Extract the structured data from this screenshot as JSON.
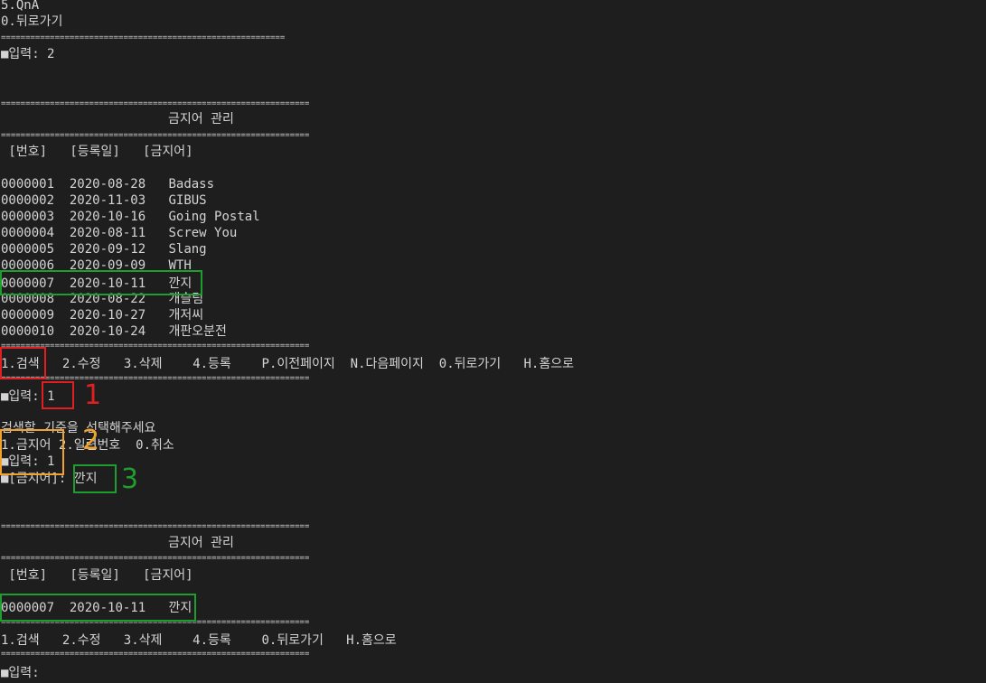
{
  "menu_tail": {
    "line1": "5.QnA",
    "line2": "0.뒤로가기",
    "prompt": "■입력: 2"
  },
  "separator_short": "==========================================================",
  "separator_long": "===============================================================",
  "list_screen": {
    "title": "금지어 관리",
    "header": " [번호]   [등록일]   [금지어]",
    "rows": [
      {
        "no": "0000001",
        "date": "2020-08-28",
        "word": "Badass"
      },
      {
        "no": "0000002",
        "date": "2020-11-03",
        "word": "GIBUS"
      },
      {
        "no": "0000003",
        "date": "2020-10-16",
        "word": "Going Postal"
      },
      {
        "no": "0000004",
        "date": "2020-08-11",
        "word": "Screw You"
      },
      {
        "no": "0000005",
        "date": "2020-09-12",
        "word": "Slang"
      },
      {
        "no": "0000006",
        "date": "2020-09-09",
        "word": "WTH"
      },
      {
        "no": "0000007",
        "date": "2020-10-11",
        "word": "깐지"
      },
      {
        "no": "0000008",
        "date": "2020-08-22",
        "word": "개슬림"
      },
      {
        "no": "0000009",
        "date": "2020-10-27",
        "word": "개저씨"
      },
      {
        "no": "0000010",
        "date": "2020-10-24",
        "word": "개판오분전"
      }
    ],
    "menu": {
      "search": "1.검색",
      "edit": "2.수정",
      "delete": "3.삭제",
      "register": "4.등록",
      "prev": "P.이전페이지",
      "next": "N.다음페이지",
      "back": "0.뒤로가기",
      "home": "H.홈으로"
    },
    "prompt_label": "■입력:",
    "prompt_value": "1"
  },
  "search_dialog": {
    "question": "검색할 기준을 선택해주세요",
    "options": "1.금지어 2.일련번호  0.취소",
    "prompt": "■입력: 1",
    "field_label": "■[금지어]:",
    "field_value": "깐지"
  },
  "result_screen": {
    "title": "금지어 관리",
    "header": " [번호]   [등록일]   [금지어]",
    "row": {
      "no": "0000007",
      "date": "2020-10-11",
      "word": "깐지"
    },
    "menu": "1.검색   2.수정   3.삭제    4.등록    0.뒤로가기   H.홈으로",
    "prompt": "■입력:"
  },
  "annotations": {
    "step1": "1",
    "step2": "2",
    "step3": "3"
  },
  "colors": {
    "background": "#1e1e1e",
    "text": "#d4d4d4",
    "annotation_red": "#e02020",
    "annotation_green": "#1e9e2e",
    "annotation_orange": "#f2a22a"
  }
}
